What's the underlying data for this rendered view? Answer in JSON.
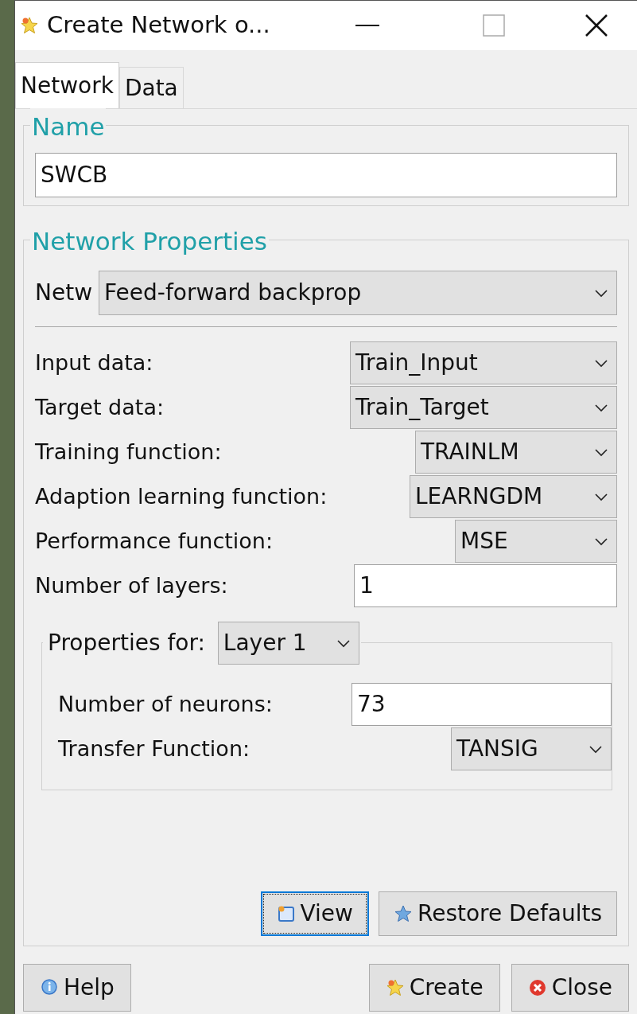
{
  "window": {
    "title": "Create Network o..."
  },
  "tabs": [
    {
      "label": "Network",
      "selected": true
    },
    {
      "label": "Data",
      "selected": false
    }
  ],
  "name_group": {
    "legend": "Name",
    "value": "SWCB"
  },
  "properties_group": {
    "legend": "Network Properties",
    "network_type": {
      "label": "Netw",
      "value": "Feed-forward backprop"
    },
    "fields": [
      {
        "label": "Input data:",
        "kind": "dropdown",
        "value": "Train_Input"
      },
      {
        "label": "Target data:",
        "kind": "dropdown",
        "value": "Train_Target"
      },
      {
        "label": "Training function:",
        "kind": "dropdown",
        "value": "TRAINLM"
      },
      {
        "label": "Adaption learning function:",
        "kind": "dropdown",
        "value": "LEARNGDM"
      },
      {
        "label": "Performance function:",
        "kind": "dropdown",
        "value": "MSE"
      },
      {
        "label": "Number of layers:",
        "kind": "input",
        "value": "1"
      }
    ],
    "layer_group": {
      "label": "Properties for:",
      "selection": "Layer 1",
      "fields": [
        {
          "label": "Number of neurons:",
          "kind": "input",
          "value": "73"
        },
        {
          "label": "Transfer Function:",
          "kind": "dropdown",
          "value": "TANSIG"
        }
      ]
    },
    "buttons": [
      {
        "label": "View",
        "focused": true
      },
      {
        "label": "Restore Defaults",
        "focused": false
      }
    ]
  },
  "footer_buttons": [
    {
      "label": "Help"
    },
    {
      "label": "Create"
    },
    {
      "label": "Close"
    }
  ]
}
